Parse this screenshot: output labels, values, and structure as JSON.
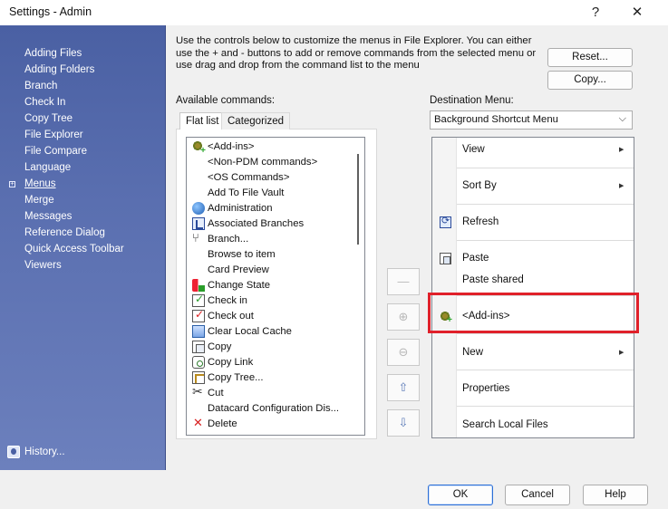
{
  "window": {
    "title": "Settings - Admin",
    "help_glyph": "?",
    "close_glyph": "✕"
  },
  "sidebar": {
    "items": [
      {
        "label": "Adding Files"
      },
      {
        "label": "Adding Folders"
      },
      {
        "label": "Branch"
      },
      {
        "label": "Check In"
      },
      {
        "label": "Copy Tree"
      },
      {
        "label": "File Explorer"
      },
      {
        "label": "File Compare"
      },
      {
        "label": "Language"
      },
      {
        "label": "Menus",
        "active": true
      },
      {
        "label": "Merge"
      },
      {
        "label": "Messages"
      },
      {
        "label": "Reference Dialog"
      },
      {
        "label": "Quick Access Toolbar"
      },
      {
        "label": "Viewers"
      }
    ],
    "expander_glyph": "+",
    "history_label": "History..."
  },
  "description": "Use the controls below to customize the menus in File Explorer. You can either use the + and - buttons to add or remove commands from the selected menu or use drag and drop from the command list to the menu",
  "buttons": {
    "reset": "Reset...",
    "copy": "Copy...",
    "ok": "OK",
    "cancel": "Cancel",
    "help": "Help"
  },
  "available": {
    "label": "Available commands:",
    "tabs": [
      "Flat list",
      "Categorized"
    ],
    "items": [
      {
        "label": "<Add-ins>",
        "icon": "addin-icon"
      },
      {
        "label": "<Non-PDM commands>",
        "icon": ""
      },
      {
        "label": "<OS Commands>",
        "icon": ""
      },
      {
        "label": "Add To File Vault",
        "icon": ""
      },
      {
        "label": "Administration",
        "icon": "administration-icon"
      },
      {
        "label": "Associated Branches",
        "icon": "associated-branches-icon"
      },
      {
        "label": "Branch...",
        "icon": "branch-icon"
      },
      {
        "label": "Browse to item",
        "icon": ""
      },
      {
        "label": "Card Preview",
        "icon": ""
      },
      {
        "label": "Change State",
        "icon": "change-state-icon"
      },
      {
        "label": "Check in",
        "icon": "check-in-icon"
      },
      {
        "label": "Check out",
        "icon": "check-out-icon"
      },
      {
        "label": "Clear Local Cache",
        "icon": "clear-cache-icon"
      },
      {
        "label": "Copy",
        "icon": "copy-icon"
      },
      {
        "label": "Copy Link",
        "icon": "copy-link-icon"
      },
      {
        "label": "Copy Tree...",
        "icon": "copy-tree-icon"
      },
      {
        "label": "Cut",
        "icon": "cut-icon"
      },
      {
        "label": "Datacard Configuration Dis...",
        "icon": ""
      },
      {
        "label": "Delete",
        "icon": "delete-icon"
      }
    ]
  },
  "middle_buttons": {
    "separator": "—",
    "add": "⊕",
    "remove": "⊖",
    "up": "⇧",
    "down": "⇩"
  },
  "destination": {
    "label": "Destination Menu:",
    "selected": "Background Shortcut Menu",
    "items": [
      {
        "label": "View",
        "submenu": true,
        "icon": ""
      },
      {
        "label": "Sort By",
        "submenu": true,
        "icon": ""
      },
      {
        "label": "Refresh",
        "submenu": false,
        "icon": "refresh-icon"
      },
      {
        "label": "Paste",
        "submenu": false,
        "icon": "paste-icon"
      },
      {
        "label": "Paste shared",
        "submenu": false,
        "icon": ""
      },
      {
        "label": "<Add-ins>",
        "submenu": false,
        "icon": "addin-icon",
        "highlighted": true
      },
      {
        "label": "New",
        "submenu": true,
        "icon": ""
      },
      {
        "label": "Properties",
        "submenu": false,
        "icon": ""
      },
      {
        "label": "Search Local Files",
        "submenu": false,
        "icon": ""
      }
    ],
    "submenu_arrow": "▶"
  },
  "colors": {
    "sidebar": "#5a6fb0",
    "highlight": "#e0202a",
    "primary_border": "#2c6fd6"
  }
}
